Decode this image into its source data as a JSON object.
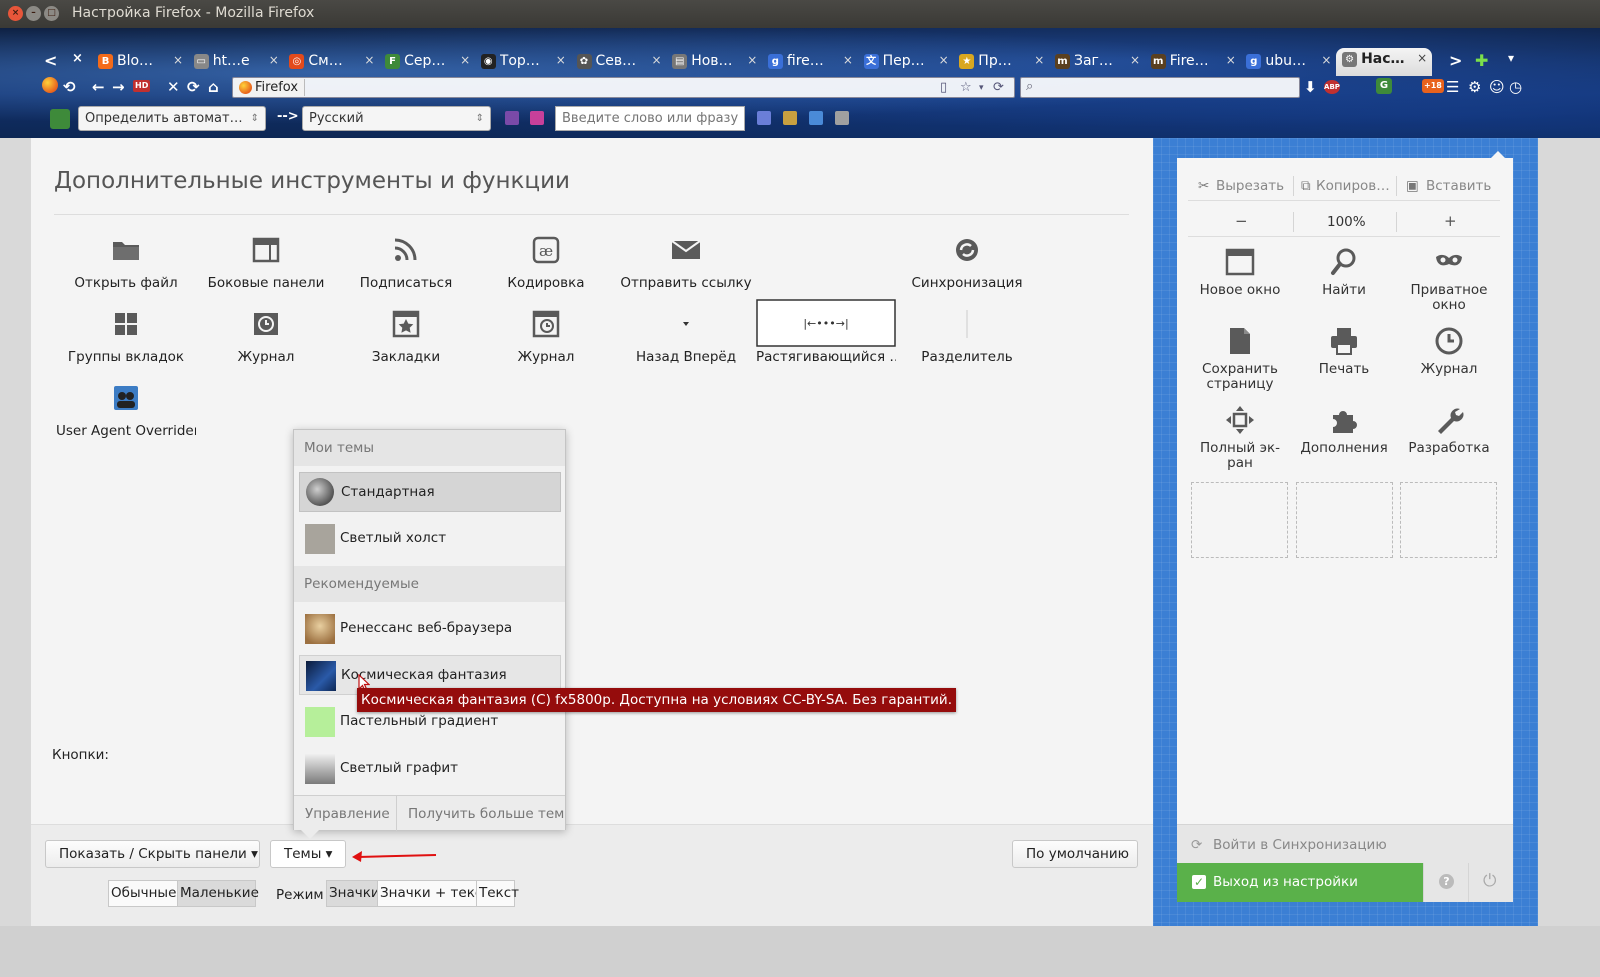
{
  "window": {
    "title": "Настройка Firefox - Mozilla Firefox",
    "close": "×",
    "minimize": "–",
    "maximize": "□"
  },
  "tabs": [
    {
      "label": "Blo…",
      "fav_color": "#f46b1a",
      "fav_glyph": "B"
    },
    {
      "label": "ht…e",
      "fav_color": "#888888",
      "fav_glyph": "▭"
    },
    {
      "label": "См…",
      "fav_color": "#e34a1b",
      "fav_glyph": "◎"
    },
    {
      "label": "Сер…",
      "fav_color": "#3e8a3a",
      "fav_glyph": "F"
    },
    {
      "label": "Тор…",
      "fav_color": "#222222",
      "fav_glyph": "◉"
    },
    {
      "label": "Сев…",
      "fav_color": "#555555",
      "fav_glyph": "✿"
    },
    {
      "label": "Нов…",
      "fav_color": "#777777",
      "fav_glyph": "▤"
    },
    {
      "label": "fire…",
      "fav_color": "#3a6fd8",
      "fav_glyph": "g"
    },
    {
      "label": "Пер…",
      "fav_color": "#3a6fd8",
      "fav_glyph": "文"
    },
    {
      "label": "Пр…",
      "fav_color": "#d9a720",
      "fav_glyph": "★"
    },
    {
      "label": "Заг…",
      "fav_color": "#5a4020",
      "fav_glyph": "m"
    },
    {
      "label": "Fire…",
      "fav_color": "#5a4020",
      "fav_glyph": "m"
    },
    {
      "label": "ubu…",
      "fav_color": "#3a6fd8",
      "fav_glyph": "g"
    },
    {
      "label": "Нас…",
      "fav_color": "#777777",
      "fav_glyph": "⚙",
      "active": true
    }
  ],
  "tab_close": "×",
  "tab_scroll_left": "<",
  "tab_scroll_right": ">",
  "new_tab": "✚",
  "tab_list": "▾",
  "navbar": {
    "back": "←",
    "forward": "→",
    "hd_badge": "HD",
    "stop": "✕",
    "reload": "⟳",
    "home": "⌂",
    "identity": "Firefox",
    "url": "",
    "reader_icon": "▯",
    "star_icon": "☆",
    "reload_small": "⟳",
    "search_placeholder": "",
    "download_icon": "⬇",
    "abp_badge": "ABP",
    "weather_badge": "+18",
    "menu_icon": "☰"
  },
  "translator": {
    "from_lang": "Определить автомат…",
    "arrow": "-->",
    "to_lang": "Русский",
    "input_placeholder": "Введите слово или фразу"
  },
  "main": {
    "title": "Дополнительные инструменты и функции",
    "tools": [
      {
        "label": "Открыть файл",
        "icon": "folder-icon"
      },
      {
        "label": "Боковые панели",
        "icon": "sidebar-icon"
      },
      {
        "label": "Подписаться",
        "icon": "rss-icon"
      },
      {
        "label": "Кодировка",
        "icon": "encoding-icon"
      },
      {
        "label": "Отправить ссылку",
        "icon": "mail-icon"
      },
      {
        "label": "Синхронизация",
        "icon": "sync-icon"
      },
      {
        "label": "Группы вкладок",
        "icon": "tab-groups-icon"
      },
      {
        "label": "Журнал",
        "icon": "history-icon"
      },
      {
        "label": "Закладки",
        "icon": "bookmarks-icon"
      },
      {
        "label": "Журнал",
        "icon": "history-panel-icon"
      },
      {
        "label": "Назад Вперёд",
        "icon": "back-forward-icon"
      },
      {
        "label": "Растягивающийся …",
        "icon": "flexible-space-icon"
      },
      {
        "label": "Разделитель",
        "icon": "separator-icon"
      },
      {
        "label": "User Agent Overrider",
        "icon": "user-agent-icon"
      }
    ]
  },
  "bottom": {
    "show_hide_panels": "Показать / Скрыть панели ▾",
    "themes": "Темы ▾",
    "restore_defaults": "По умолчанию",
    "buttons_label": "Кнопки:",
    "buttons_normal": "Обычные",
    "buttons_small": "Маленькие",
    "mode_label": "Режим",
    "mode_icons": "Значки",
    "mode_icons_text": "Значки + текст",
    "mode_text": "Текст"
  },
  "themes_popup": {
    "my_themes_header": "Мои темы",
    "my_themes": [
      {
        "name": "Стандартная",
        "selected": true
      },
      {
        "name": "Светлый холст"
      }
    ],
    "recommended_header": "Рекомендуемые",
    "recommended": [
      {
        "name": "Ренессанс веб-браузера"
      },
      {
        "name": "Космическая фантазия",
        "hovered": true
      },
      {
        "name": "Пастельный градиент"
      },
      {
        "name": "Светлый графит"
      }
    ],
    "manage": "Управление",
    "get_more": "Получить больше тем"
  },
  "tooltip": "Космическая фантазия (C) fx5800p. Доступна на условиях CC-BY-SA. Без гарантий.",
  "panel": {
    "cut": "Вырезать",
    "copy": "Копиров…",
    "paste": "Вставить",
    "zoom_out": "−",
    "zoom_level": "100%",
    "zoom_in": "+",
    "items": [
      {
        "label": "Новое окно",
        "icon": "new-window-icon"
      },
      {
        "label": "Найти",
        "icon": "find-icon"
      },
      {
        "label": "Приватное окно",
        "icon": "private-window-icon"
      },
      {
        "label": "Сохранить страницу",
        "icon": "save-page-icon"
      },
      {
        "label": "Печать",
        "icon": "print-icon"
      },
      {
        "label": "Журнал",
        "icon": "history-icon"
      },
      {
        "label": "Полный эк-ран",
        "icon": "fullscreen-icon"
      },
      {
        "label": "Дополнения",
        "icon": "addons-icon"
      },
      {
        "label": "Разработка",
        "icon": "developer-icon"
      }
    ],
    "sync_login": "Войти в Синхронизацию",
    "exit_customize": "Выход из настройки",
    "help": "?",
    "quit": "⏻"
  },
  "colors": {
    "accent_green": "#5ab14a",
    "panel_blue": "#3b7fd4",
    "tooltip_red": "#950c0c"
  }
}
